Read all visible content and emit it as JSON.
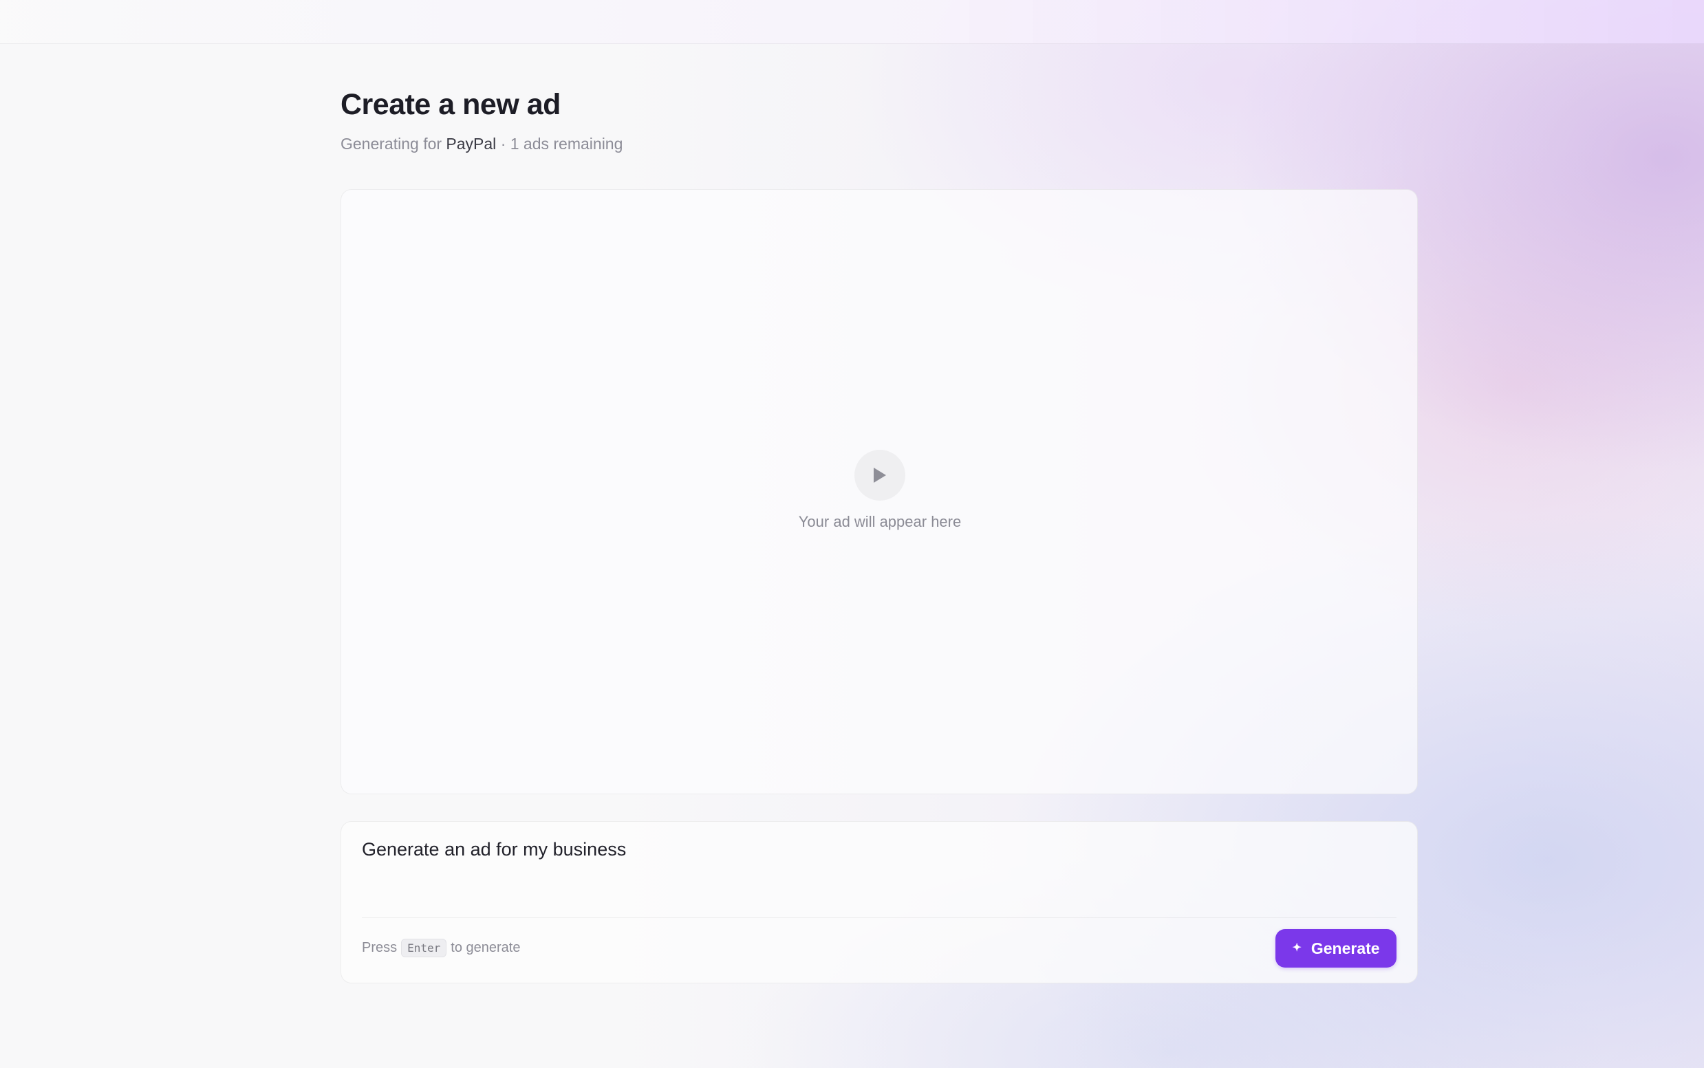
{
  "page": {
    "title": "Create a new ad",
    "subtitle_prefix": "Generating for",
    "brand": "PayPal",
    "subtitle_suffix": "· 1 ads remaining"
  },
  "preview": {
    "placeholder": "Your ad will appear here",
    "icon": "play-icon"
  },
  "prompt": {
    "value": "Generate an ad for my business",
    "hint_prefix": "Press",
    "hint_key": "Enter",
    "hint_suffix": "to generate"
  },
  "generate_button": {
    "label": "Generate",
    "icon": "sparkle-icon",
    "color": "#7b38ea"
  }
}
